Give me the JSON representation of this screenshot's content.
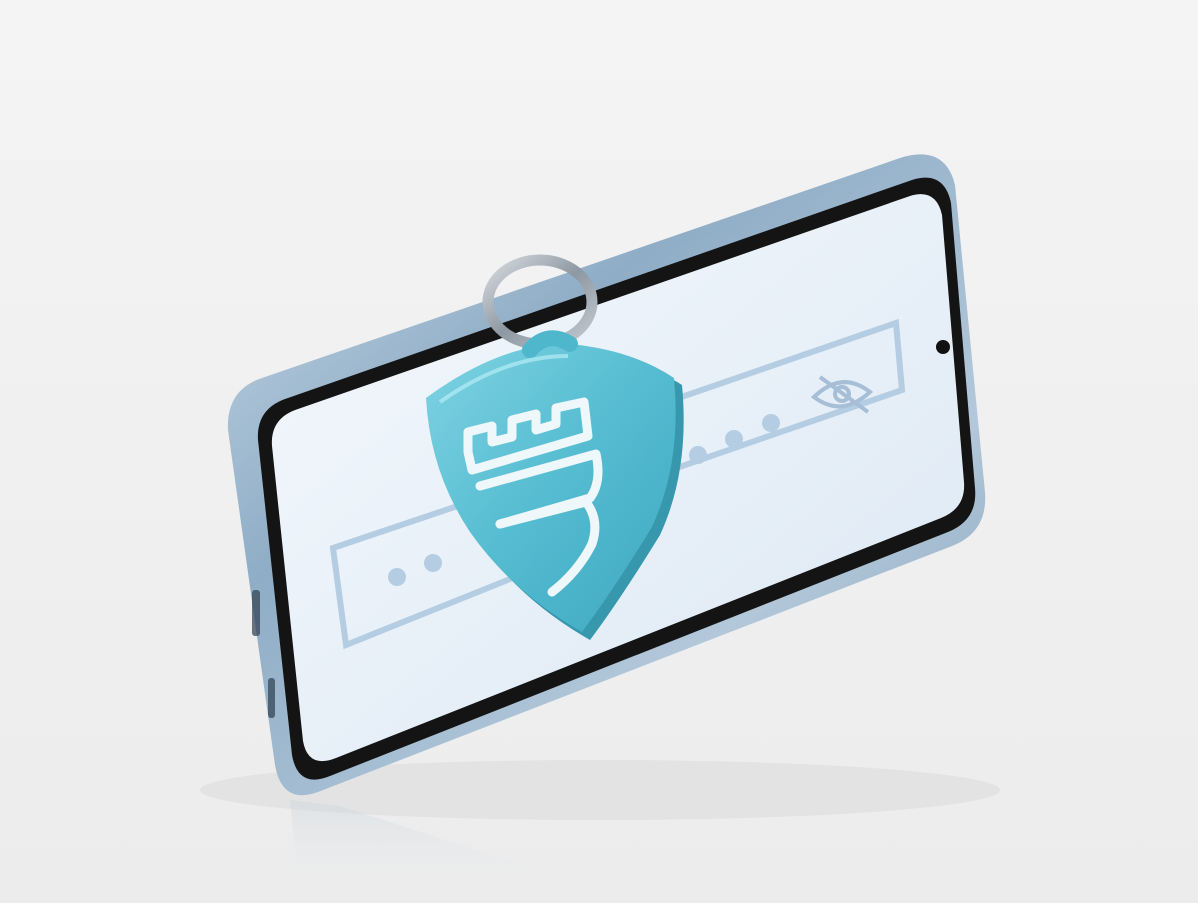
{
  "scene": {
    "subject": "phone-with-security-keychain",
    "colors": {
      "background": "#f1f1f1",
      "phone_frame": "#9fb9cf",
      "phone_bezel": "#141414",
      "screen": "#eaf1f8",
      "screen_graphic": "#b5cde2",
      "shield": "#5bbfd3",
      "shield_emblem": "#eef7fa",
      "ring": "#9aa3ab"
    },
    "screen": {
      "fields": [
        {
          "id": "password-field-top",
          "masked_dots": 3,
          "has_hidden_eye_icon": true
        },
        {
          "id": "password-field-bottom",
          "masked_dots": 2,
          "has_hidden_eye_icon": false
        }
      ]
    },
    "icons": [
      "shield-icon",
      "eye-slash-icon",
      "camera-hole-icon",
      "key-ring-icon"
    ]
  }
}
